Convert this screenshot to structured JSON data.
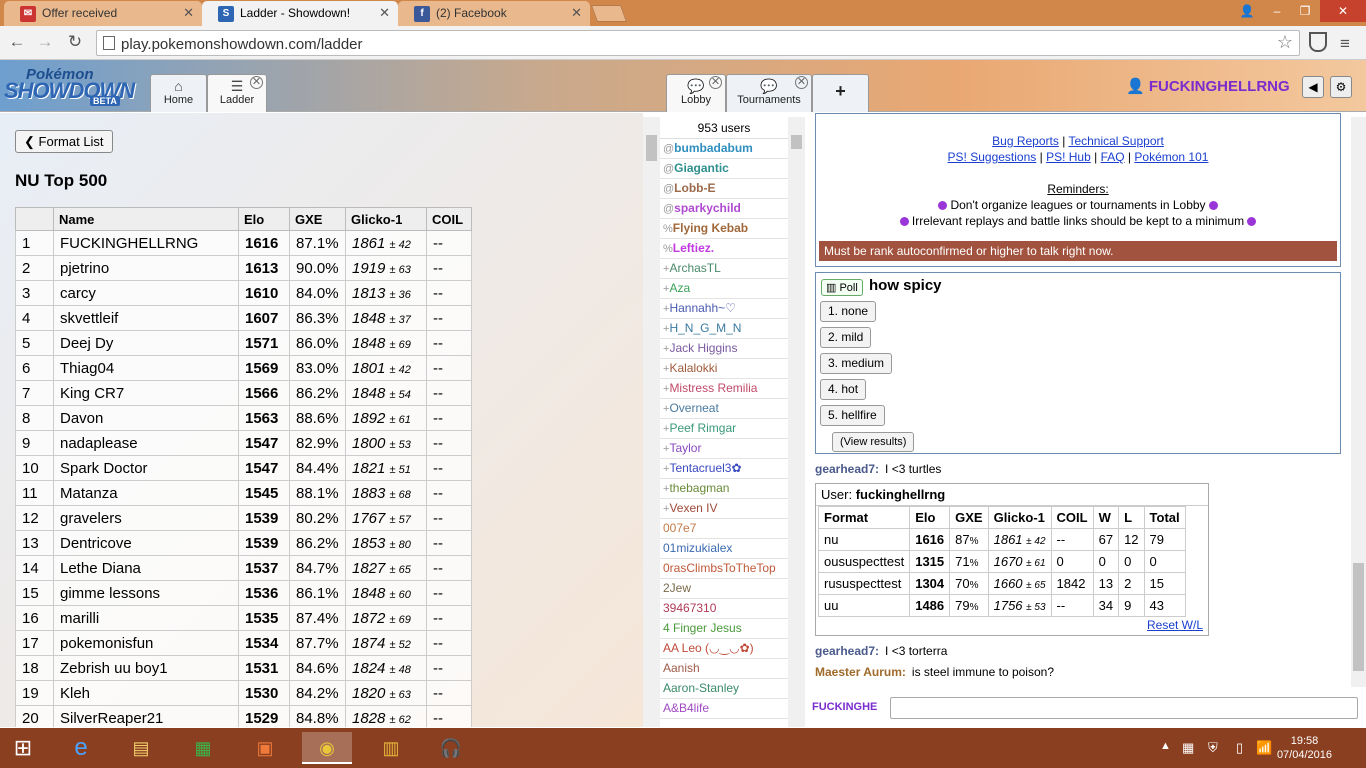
{
  "browser": {
    "tabs": [
      {
        "label": "Offer received",
        "icon": "mail-icon"
      },
      {
        "label": "Ladder - Showdown!",
        "icon": "showdown-icon"
      },
      {
        "label": "(2) Facebook",
        "icon": "facebook-icon"
      }
    ],
    "url": "play.pokemonshowdown.com/ladder"
  },
  "ps": {
    "logo_top": "Pokémon",
    "logo_main": "SHOWDOWN",
    "logo_badge": "BETA",
    "tabs_left": [
      {
        "label": "Home"
      },
      {
        "label": "Ladder"
      }
    ],
    "tabs_right": [
      {
        "label": "Lobby"
      },
      {
        "label": "Tournaments"
      }
    ],
    "username": "FUCKINGHELLRNG"
  },
  "ladder": {
    "format_button": "Format List",
    "title": "NU Top 500",
    "columns": [
      "",
      "Name",
      "Elo",
      "GXE",
      "Glicko-1",
      "COIL"
    ],
    "rows": [
      {
        "rank": "1",
        "name": "FUCKINGHELLRNG",
        "elo": "1616",
        "gxe": "87.1%",
        "glicko": "1861",
        "dev": "± 42",
        "coil": "--"
      },
      {
        "rank": "2",
        "name": "pjetrino",
        "elo": "1613",
        "gxe": "90.0%",
        "glicko": "1919",
        "dev": "± 63",
        "coil": "--"
      },
      {
        "rank": "3",
        "name": "carcy",
        "elo": "1610",
        "gxe": "84.0%",
        "glicko": "1813",
        "dev": "± 36",
        "coil": "--"
      },
      {
        "rank": "4",
        "name": "skvettleif",
        "elo": "1607",
        "gxe": "86.3%",
        "glicko": "1848",
        "dev": "± 37",
        "coil": "--"
      },
      {
        "rank": "5",
        "name": "Deej Dy",
        "elo": "1571",
        "gxe": "86.0%",
        "glicko": "1848",
        "dev": "± 69",
        "coil": "--"
      },
      {
        "rank": "6",
        "name": "Thiag04",
        "elo": "1569",
        "gxe": "83.0%",
        "glicko": "1801",
        "dev": "± 42",
        "coil": "--"
      },
      {
        "rank": "7",
        "name": "King CR7",
        "elo": "1566",
        "gxe": "86.2%",
        "glicko": "1848",
        "dev": "± 54",
        "coil": "--"
      },
      {
        "rank": "8",
        "name": "Davon",
        "elo": "1563",
        "gxe": "88.6%",
        "glicko": "1892",
        "dev": "± 61",
        "coil": "--"
      },
      {
        "rank": "9",
        "name": "nadaplease",
        "elo": "1547",
        "gxe": "82.9%",
        "glicko": "1800",
        "dev": "± 53",
        "coil": "--"
      },
      {
        "rank": "10",
        "name": "Spark Doctor",
        "elo": "1547",
        "gxe": "84.4%",
        "glicko": "1821",
        "dev": "± 51",
        "coil": "--"
      },
      {
        "rank": "11",
        "name": "Matanza",
        "elo": "1545",
        "gxe": "88.1%",
        "glicko": "1883",
        "dev": "± 68",
        "coil": "--"
      },
      {
        "rank": "12",
        "name": "gravelers",
        "elo": "1539",
        "gxe": "80.2%",
        "glicko": "1767",
        "dev": "± 57",
        "coil": "--"
      },
      {
        "rank": "13",
        "name": "Dentricove",
        "elo": "1539",
        "gxe": "86.2%",
        "glicko": "1853",
        "dev": "± 80",
        "coil": "--"
      },
      {
        "rank": "14",
        "name": "Lethe Diana",
        "elo": "1537",
        "gxe": "84.7%",
        "glicko": "1827",
        "dev": "± 65",
        "coil": "--"
      },
      {
        "rank": "15",
        "name": "gimme lessons",
        "elo": "1536",
        "gxe": "86.1%",
        "glicko": "1848",
        "dev": "± 60",
        "coil": "--"
      },
      {
        "rank": "16",
        "name": "marilli",
        "elo": "1535",
        "gxe": "87.4%",
        "glicko": "1872",
        "dev": "± 69",
        "coil": "--"
      },
      {
        "rank": "17",
        "name": "pokemonisfun",
        "elo": "1534",
        "gxe": "87.7%",
        "glicko": "1874",
        "dev": "± 52",
        "coil": "--"
      },
      {
        "rank": "18",
        "name": "Zebrish uu boy1",
        "elo": "1531",
        "gxe": "84.6%",
        "glicko": "1824",
        "dev": "± 48",
        "coil": "--"
      },
      {
        "rank": "19",
        "name": "Kleh",
        "elo": "1530",
        "gxe": "84.2%",
        "glicko": "1820",
        "dev": "± 63",
        "coil": "--"
      },
      {
        "rank": "20",
        "name": "SilverReaper21",
        "elo": "1529",
        "gxe": "84.8%",
        "glicko": "1828",
        "dev": "± 62",
        "coil": "--"
      }
    ]
  },
  "userlist": {
    "count": "953 users",
    "users": [
      {
        "rank": "@",
        "name": "bumbadabum",
        "color": "#2f8fbf",
        "bold": true
      },
      {
        "rank": "@",
        "name": "Giagantic",
        "color": "#2f8f8f",
        "bold": true
      },
      {
        "rank": "@",
        "name": "Lobb-E",
        "color": "#9a6a4a",
        "bold": true
      },
      {
        "rank": "@",
        "name": "sparkychild",
        "color": "#b04ad0",
        "bold": true
      },
      {
        "rank": "%",
        "name": "Flying Kebab",
        "color": "#a0683a",
        "bold": true
      },
      {
        "rank": "%",
        "name": "Leftiez.",
        "color": "#c03adf",
        "bold": true
      },
      {
        "rank": "+",
        "name": "ArchasTL",
        "color": "#4a8a6a",
        "bold": false
      },
      {
        "rank": "+",
        "name": "Aza",
        "color": "#3aa05a",
        "bold": false
      },
      {
        "rank": "+",
        "name": "Hannahh~♡",
        "color": "#4a5ab0",
        "bold": false
      },
      {
        "rank": "+",
        "name": "H_N_G_M_N",
        "color": "#3a7aa0",
        "bold": false
      },
      {
        "rank": "+",
        "name": "Jack Higgins",
        "color": "#7a5aa0",
        "bold": false
      },
      {
        "rank": "+",
        "name": "Kalalokki",
        "color": "#a05a3a",
        "bold": false
      },
      {
        "rank": "+",
        "name": "Mistress Remilia",
        "color": "#c04a6a",
        "bold": false
      },
      {
        "rank": "+",
        "name": "Overneat",
        "color": "#4a7aa0",
        "bold": false
      },
      {
        "rank": "+",
        "name": "Peef Rimgar",
        "color": "#3a9a7a",
        "bold": false
      },
      {
        "rank": "+",
        "name": "Taylor",
        "color": "#8a4ac0",
        "bold": false
      },
      {
        "rank": "+",
        "name": "Tentacruel3✿",
        "color": "#3a4ac0",
        "bold": false
      },
      {
        "rank": "+",
        "name": "thebagman",
        "color": "#6a8a3a",
        "bold": false
      },
      {
        "rank": "+",
        "name": "Vexen IV",
        "color": "#a04a3a",
        "bold": false
      },
      {
        "rank": "",
        "name": "007e7",
        "color": "#c07a4a",
        "bold": false
      },
      {
        "rank": "",
        "name": "01mizukialex",
        "color": "#3a6ab0",
        "bold": false
      },
      {
        "rank": "",
        "name": "0rasClimbsToTheTop",
        "color": "#c05a3a",
        "bold": false
      },
      {
        "rank": "",
        "name": "2Jew",
        "color": "#7a6a4a",
        "bold": false
      },
      {
        "rank": "",
        "name": "39467310",
        "color": "#b03a5a",
        "bold": false
      },
      {
        "rank": "",
        "name": "4 Finger Jesus",
        "color": "#4a9a3a",
        "bold": false
      },
      {
        "rank": "",
        "name": "AA Leo (◡‿◡✿)",
        "color": "#c04a3a",
        "bold": false
      },
      {
        "rank": "",
        "name": "Aanish",
        "color": "#a05a4a",
        "bold": false
      },
      {
        "rank": "",
        "name": "Aaron-Stanley",
        "color": "#3a8a6a",
        "bold": false
      },
      {
        "rank": "",
        "name": "A&B4life",
        "color": "#a04ac0",
        "bold": false
      }
    ]
  },
  "chat": {
    "info": {
      "link1": "Bug Reports",
      "link2": "Technical Support",
      "link3": "PS! Suggestions",
      "link4": "PS! Hub",
      "link5": "FAQ",
      "link6": "Pokémon 101",
      "reminders_title": "Reminders:",
      "reminder1": "Don't organize leagues or tournaments in Lobby",
      "reminder2": "Irrelevant replays and battle links should be kept to a minimum",
      "rank_notice": "Must be rank autoconfirmed or higher to talk right now."
    },
    "poll": {
      "tag": "Poll",
      "title": "how spicy",
      "options": [
        "1. none",
        "2. mild",
        "3. medium",
        "4. hot",
        "5. hellfire"
      ],
      "view_results": "(View results)"
    },
    "messages": [
      {
        "user": "gearhead7:",
        "text": "I <3 turtles",
        "color": "#4a5a8a"
      },
      {
        "user": "gearhead7:",
        "text": "I <3 torterra",
        "color": "#4a5a8a"
      },
      {
        "user": "Maester Aurum:",
        "text": "is steel immune to poison?",
        "color": "#a06a2a"
      }
    ],
    "usercard": {
      "label": "User:",
      "name": "fuckinghellrng",
      "columns": [
        "Format",
        "Elo",
        "GXE",
        "Glicko-1",
        "COIL",
        "W",
        "L",
        "Total"
      ],
      "rows": [
        {
          "format": "nu",
          "elo": "1616",
          "gxe": "87",
          "glicko": "1861",
          "dev": "± 42",
          "coil": "--",
          "w": "67",
          "l": "12",
          "total": "79"
        },
        {
          "format": "oususpecttest",
          "elo": "1315",
          "gxe": "71",
          "glicko": "1670",
          "dev": "± 61",
          "coil": "0",
          "w": "0",
          "l": "0",
          "total": "0"
        },
        {
          "format": "rususpecttest",
          "elo": "1304",
          "gxe": "70",
          "glicko": "1660",
          "dev": "± 65",
          "coil": "1842",
          "w": "13",
          "l": "2",
          "total": "15"
        },
        {
          "format": "uu",
          "elo": "1486",
          "gxe": "79",
          "glicko": "1756",
          "dev": "± 53",
          "coil": "--",
          "w": "34",
          "l": "9",
          "total": "43"
        }
      ],
      "gxe_unit": "%",
      "reset": "Reset W/L"
    },
    "input_name": "FUCKINGHE"
  },
  "taskbar": {
    "time": "19:58",
    "date": "07/04/2016"
  }
}
